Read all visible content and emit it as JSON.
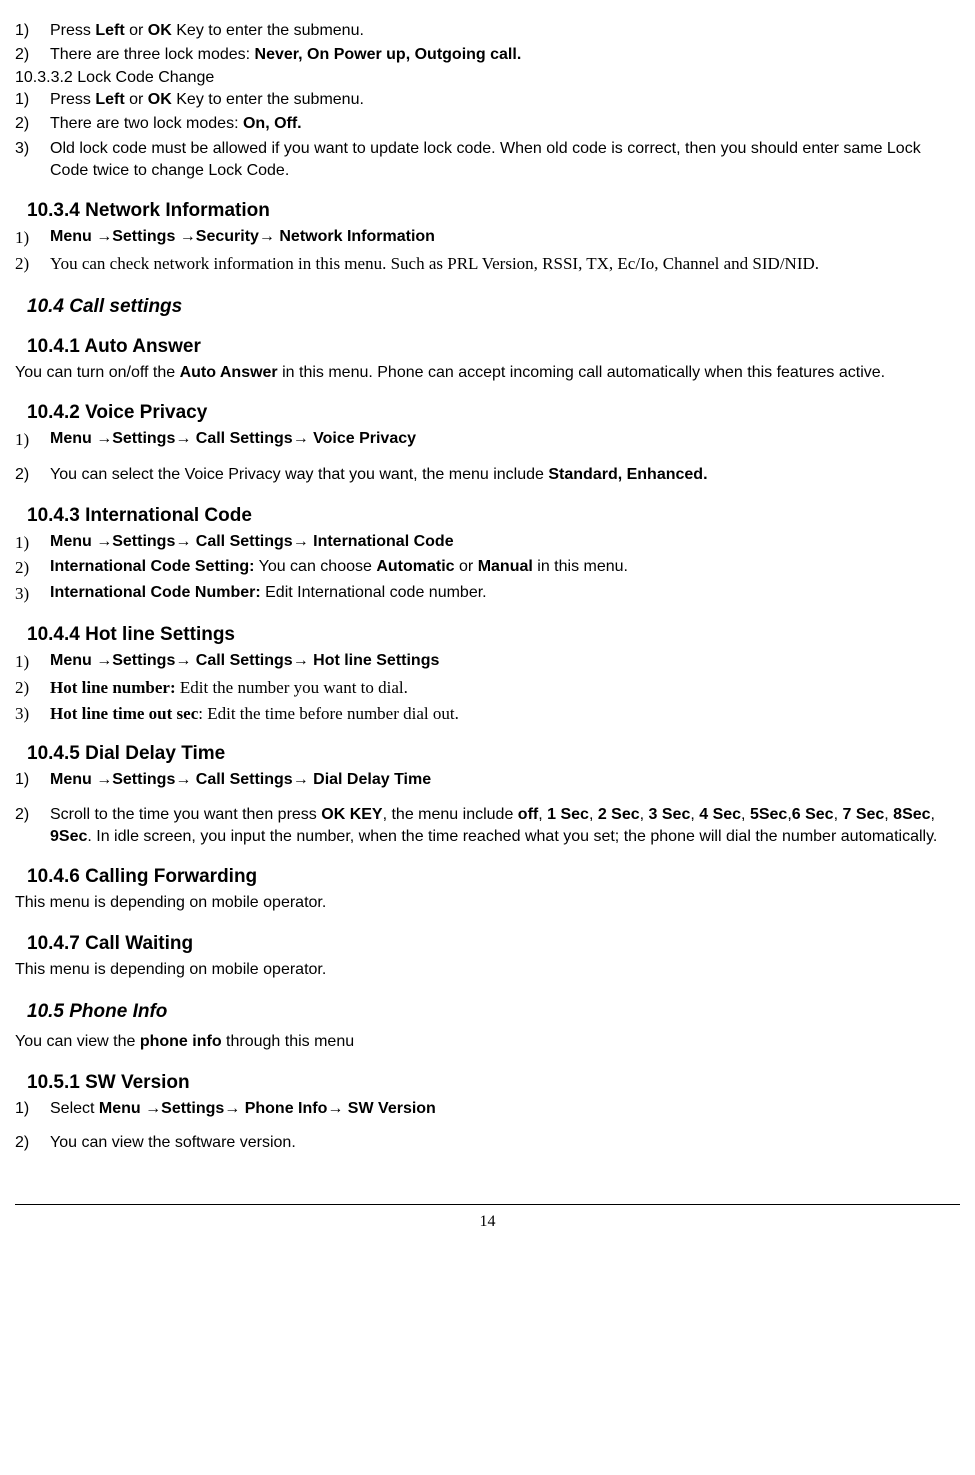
{
  "top_list": {
    "item1_marker": "1)",
    "item1_pre": "Press ",
    "item1_b1": "Left",
    "item1_mid": " or ",
    "item1_b2": "OK",
    "item1_post": " Key to enter the submenu.",
    "item2_marker": "2)",
    "item2_pre": "There are three lock modes: ",
    "item2_b": "Never, On Power up, Outgoing call."
  },
  "sub_10332": "10.3.3.2  Lock Code Change",
  "lock_code": {
    "item1_marker": "1)",
    "item1_pre": "Press ",
    "item1_b1": "Left",
    "item1_mid": " or ",
    "item1_b2": "OK",
    "item1_post": " Key to enter the submenu.",
    "item2_marker": "2)",
    "item2_pre": "There are two lock modes: ",
    "item2_b": "On, Off.",
    "item3_marker": "3)",
    "item3": "Old lock code must be allowed if you want to update lock code. When old code is correct, then you should enter same Lock Code twice to change Lock Code."
  },
  "h_1034": "10.3.4 Network Information",
  "net_info": {
    "item1_marker": "1)",
    "item1_b": "Menu →Settings →Security→ Network Information",
    "item2_marker": "2)",
    "item2": "You can check network information in this menu. Such as PRL Version, RSSI, TX, Ec/Io, Channel and SID/NID."
  },
  "h_104": "10.4  Call settings",
  "h_1041": "10.4.1 Auto Answer",
  "auto_answer_pre": "You can turn on/off the ",
  "auto_answer_b": "Auto Answer",
  "auto_answer_post": " in this menu. Phone can accept incoming call automatically when this features active.",
  "h_1042": "10.4.2 Voice Privacy",
  "voice_privacy": {
    "item1_marker": "1)",
    "item1_b": "Menu →Settings→ Call Settings→ Voice Privacy",
    "item2_marker": "2)",
    "item2_pre": "You can select the Voice Privacy way that you want, the menu include ",
    "item2_b": "Standard, Enhanced."
  },
  "h_1043": "10.4.3 International Code",
  "intl": {
    "item1_marker": "1)",
    "item1_b": "Menu →Settings→ Call Settings→ International Code",
    "item2_marker": "2)",
    "item2_b1": "International Code Setting:",
    "item2_mid": " You can choose ",
    "item2_b2": "Automatic",
    "item2_mid2": " or ",
    "item2_b3": "Manual",
    "item2_post": " in this menu.",
    "item3_marker": "3)",
    "item3_b": "International Code Number:",
    "item3_post": " Edit International code number."
  },
  "h_1044": "10.4.4 Hot line Settings",
  "hotline": {
    "item1_marker": "1)",
    "item1_b": "Menu →Settings→ Call Settings→ Hot line Settings",
    "item2_marker": "2)",
    "item2_b": "Hot line number:",
    "item2_post": " Edit the number you want to dial.",
    "item3_marker": "3)",
    "item3_b": "Hot line time out sec",
    "item3_post": ": Edit the time before number dial out."
  },
  "h_1045": "10.4.5 Dial Delay Time",
  "dial_delay": {
    "item1_marker": "1)",
    "item1_b": "Menu →Settings→ Call Settings→ Dial Delay Time",
    "item2_marker": "2)",
    "item2_pre": " Scroll to the time you want then press ",
    "item2_b1": "OK KEY",
    "item2_mid1": ", the menu include ",
    "item2_b2": "off",
    "item2_c1": ", ",
    "item2_b3": "1 Sec",
    "item2_c2": ", ",
    "item2_b4": "2 Sec",
    "item2_c3": ", ",
    "item2_b5": "3 Sec",
    "item2_c4": ", ",
    "item2_b6": "4 Sec",
    "item2_c5": ", ",
    "item2_b7": "5Sec",
    "item2_c6": ",",
    "item2_b8": "6 Sec",
    "item2_c7": ", ",
    "item2_b9": "7 Sec",
    "item2_c8": ", ",
    "item2_b10": "8Sec",
    "item2_c9": ", ",
    "item2_b11": "9Sec",
    "item2_post": ". In idle screen, you input the number, when the time reached what you set; the phone will dial the number automatically."
  },
  "h_1046": "10.4.6 Calling Forwarding",
  "call_fwd": "This menu is depending on mobile operator.",
  "h_1047": "10.4.7 Call Waiting",
  "call_wait": "This menu is depending on mobile operator.",
  "h_105": "10.5  Phone Info",
  "phone_info_pre": "You can view the ",
  "phone_info_b": "phone info",
  "phone_info_post": " through this menu",
  "h_1051": "10.5.1 SW Version",
  "sw": {
    "item1_marker": "1)",
    "item1_pre": "Select ",
    "item1_b": "Menu →Settings→ Phone Info→ SW Version",
    "item2_marker": "2)",
    "item2": "You can view the software version."
  },
  "page_number": "14"
}
